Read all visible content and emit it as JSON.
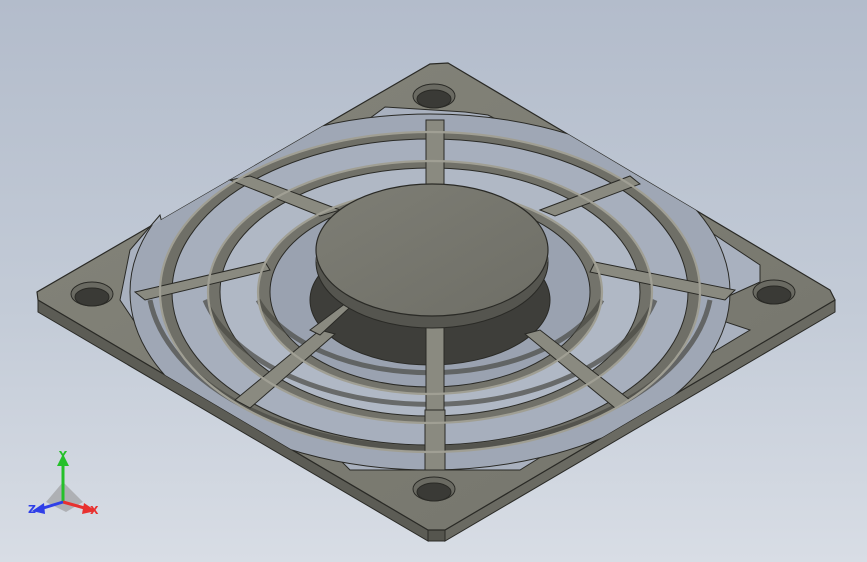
{
  "viewport": {
    "background_top": "#b3bccb",
    "background_bottom": "#d8dde5"
  },
  "model": {
    "name": "fan-guard-grille",
    "face_color": "#7c7c73",
    "edge_color": "#2a2a26",
    "highlight_color": "#a5a59a",
    "shadow_color": "#4b4b45"
  },
  "triad": {
    "x_label": "X",
    "y_label": "Y",
    "z_label": "Z",
    "x_color": "#e8312f",
    "y_color": "#25c02a",
    "z_color": "#2f3fe8"
  }
}
